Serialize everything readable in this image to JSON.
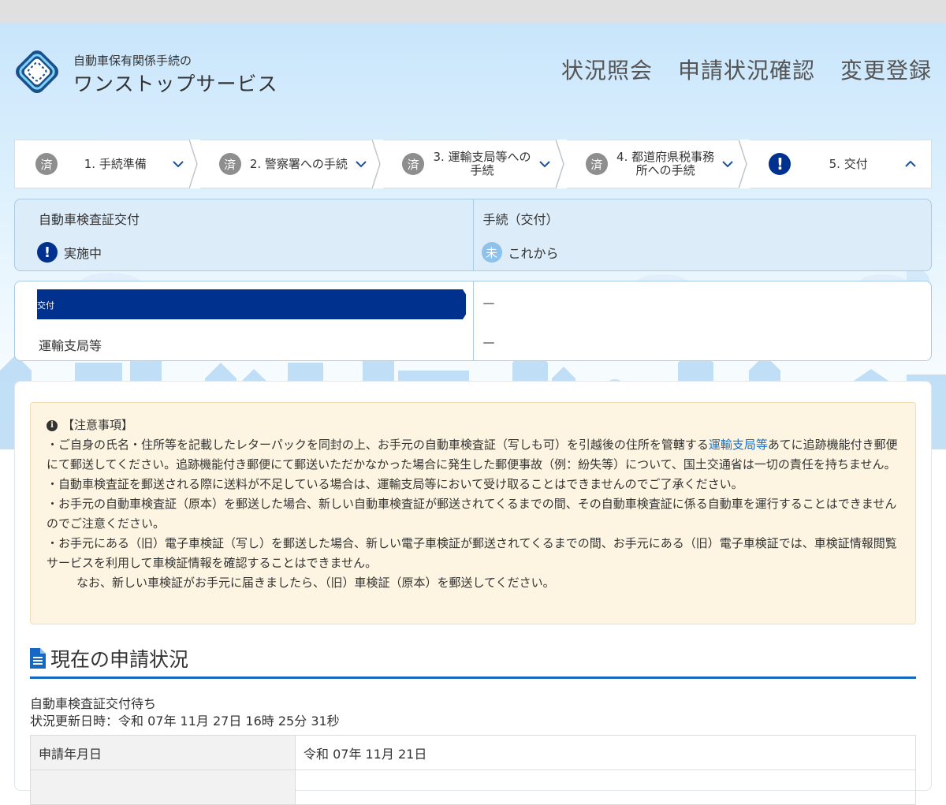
{
  "site": {
    "logo_line1": "自動車保有関係手続の",
    "logo_line2": "ワンストップサービス"
  },
  "nav": [
    "状況照会",
    "申請状況確認",
    "変更登録"
  ],
  "steps": [
    {
      "badge": "済",
      "label": "1. 手続準備",
      "state": "done"
    },
    {
      "badge": "済",
      "label": "2. 警察署への手続",
      "state": "done"
    },
    {
      "badge": "済",
      "label": "3. 運輸支局等への手続",
      "state": "done"
    },
    {
      "badge": "済",
      "label": "4. 都道府県税事務所への手続",
      "state": "done"
    },
    {
      "badge": "!",
      "label": "5. 交付",
      "state": "active"
    }
  ],
  "status_panel": {
    "left_title": "自動車検査証交付",
    "left_icon": "!",
    "left_status": "実施中",
    "right_title": "手続（交付）",
    "right_icon": "未",
    "right_status": "これから"
  },
  "detail_panel": {
    "flag_label": "交付",
    "row2_label": "運輸支局等",
    "dash1": "—",
    "dash2": "—"
  },
  "notice": {
    "title": "【注意事項】",
    "p1_before": "・ご自身の氏名・住所等を記載したレターパックを同封の上、お手元の自動車検査証（写しも可）を引越後の住所を管轄する",
    "p1_link": "運輸支局等",
    "p1_after": "あてに追跡機能付き郵便にて郵送してください。追跡機能付き郵便にて郵送いただかなかった場合に発生した郵便事故（例：紛失等）について、国土交通省は一切の責任を持ちません。",
    "p2": "・自動車検査証を郵送される際に送料が不足している場合は、運輸支局等において受け取ることはできませんのでご了承ください。",
    "p3": "・お手元の自動車検査証（原本）を郵送した場合、新しい自動車検査証が郵送されてくるまでの間、その自動車検査証に係る自動車を運行することはできませんのでご注意ください。",
    "p4": "・お手元にある（旧）電子車検証（写し）を郵送した場合、新しい電子車検証が郵送されてくるまでの間、お手元にある（旧）電子車検証では、車検証情報閲覧サービスを利用して車検証情報を確認することはできません。",
    "p5": "なお、新しい車検証がお手元に届きましたら、（旧）車検証（原本）を郵送してください。"
  },
  "section": {
    "title": "現在の申請状況",
    "status_line": "自動車検査証交付待ち",
    "updated_line": "状況更新日時：令和 07年 11月 27日 16時 25分 31秒"
  },
  "table": {
    "rows": [
      {
        "label": "申請年月日",
        "value": "令和 07年 11月 21日"
      }
    ]
  },
  "colors": {
    "accent": "#00318f",
    "link": "#1a6fc9",
    "notice_bg": "#fdf5e1",
    "panel_bg": "#dcecf8"
  }
}
